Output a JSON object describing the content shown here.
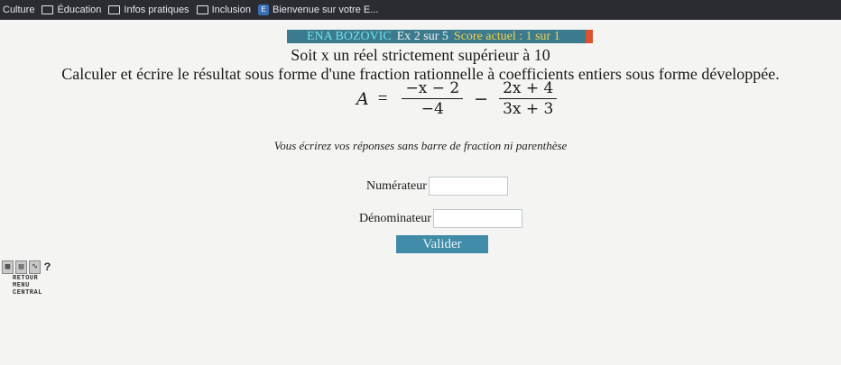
{
  "bookmarks": [
    {
      "label": "Culture",
      "icon": "folder-icon"
    },
    {
      "label": "Éducation",
      "icon": "folder-icon"
    },
    {
      "label": "Infos pratiques",
      "icon": "folder-icon"
    },
    {
      "label": "Inclusion",
      "icon": "folder-icon"
    },
    {
      "label": "Bienvenue sur votre E...",
      "icon": "favicon-icon"
    }
  ],
  "header": {
    "name": "ENA BOZOVIC",
    "exercise": "Ex 2 sur 5",
    "score": "Score actuel : 1 sur 1"
  },
  "problem": {
    "line1": "Soit x un réel strictement supérieur à 10",
    "line2": "Calculer et écrire le résultat sous forme d'une fraction rationnelle à coefficients entiers sous forme développée.",
    "formula": {
      "variable": "A",
      "equals": "=",
      "frac1_num": "−x − 2",
      "frac1_den": "−4",
      "operator": "−",
      "frac2_num": "2x + 4",
      "frac2_den": "3x + 3"
    },
    "instruction": "Vous écrirez vos réponses sans barre de fraction ni parenthèse"
  },
  "form": {
    "numerator_label": "Numérateur",
    "numerator_value": "",
    "denominator_label": "Dénominateur",
    "denominator_value": "",
    "submit_label": "Valider"
  },
  "nav": {
    "icons": [
      "calculator-icon",
      "page-icon",
      "graph-icon",
      "help-icon"
    ],
    "help_glyph": "?",
    "links": [
      "RETOUR",
      "MENU",
      "CENTRAL"
    ]
  }
}
